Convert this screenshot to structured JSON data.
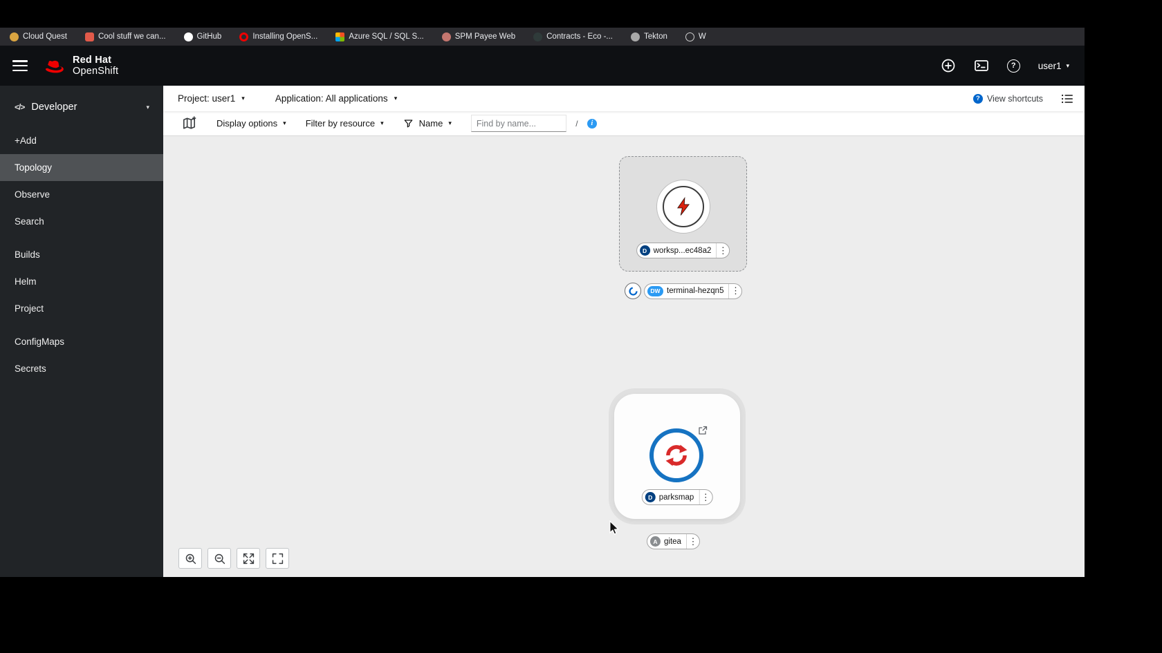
{
  "icons": {
    "caret_down": "▾",
    "kebab": "⋮",
    "question": "?",
    "info": "i",
    "code": "</>"
  },
  "browser": {
    "bookmarks": [
      {
        "label": "Cloud Quest"
      },
      {
        "label": "Cool stuff we can..."
      },
      {
        "label": "GitHub"
      },
      {
        "label": "Installing OpenS..."
      },
      {
        "label": "Azure SQL / SQL S..."
      },
      {
        "label": "SPM Payee Web"
      },
      {
        "label": "Contracts - Eco -..."
      },
      {
        "label": "Tekton"
      },
      {
        "label": "W"
      }
    ]
  },
  "masthead": {
    "brand_line1": "Red Hat",
    "brand_line2": "OpenShift",
    "user": "user1"
  },
  "sidebar": {
    "perspective": "Developer",
    "items": [
      {
        "label": "+Add"
      },
      {
        "label": "Topology"
      },
      {
        "label": "Observe"
      },
      {
        "label": "Search"
      },
      {
        "label": "Builds"
      },
      {
        "label": "Helm"
      },
      {
        "label": "Project"
      },
      {
        "label": "ConfigMaps"
      },
      {
        "label": "Secrets"
      }
    ]
  },
  "context_bar": {
    "project": "Project: user1",
    "application": "Application: All applications",
    "view_shortcuts": "View shortcuts"
  },
  "toolbar": {
    "display_options": "Display options",
    "filter_by_resource": "Filter by resource",
    "filter_type": "Name",
    "find_placeholder": "Find by name...",
    "shortcut_hint": "/"
  },
  "topology": {
    "workspace": {
      "badge": "D",
      "label": "worksp...ec48a2"
    },
    "terminal": {
      "badge": "DW",
      "label": "terminal-hezqn5"
    },
    "parksmap": {
      "badge": "D",
      "label": "parksmap"
    },
    "gitea": {
      "badge": "A",
      "label": "gitea"
    }
  },
  "colors": {
    "brand_red": "#ee0000",
    "masthead_bg": "#0e1013",
    "sidebar_bg": "#212427",
    "sidebar_active": "#4f5255",
    "canvas_bg": "#ededed",
    "deployment_badge": "#004080",
    "devworkspace_badge": "#2b9af3",
    "application_badge": "#8a8d90",
    "info_blue": "#2b9af3",
    "parksmap_ring_blue": "#1673c2",
    "parksmap_arrows_red": "#d92b2b"
  }
}
